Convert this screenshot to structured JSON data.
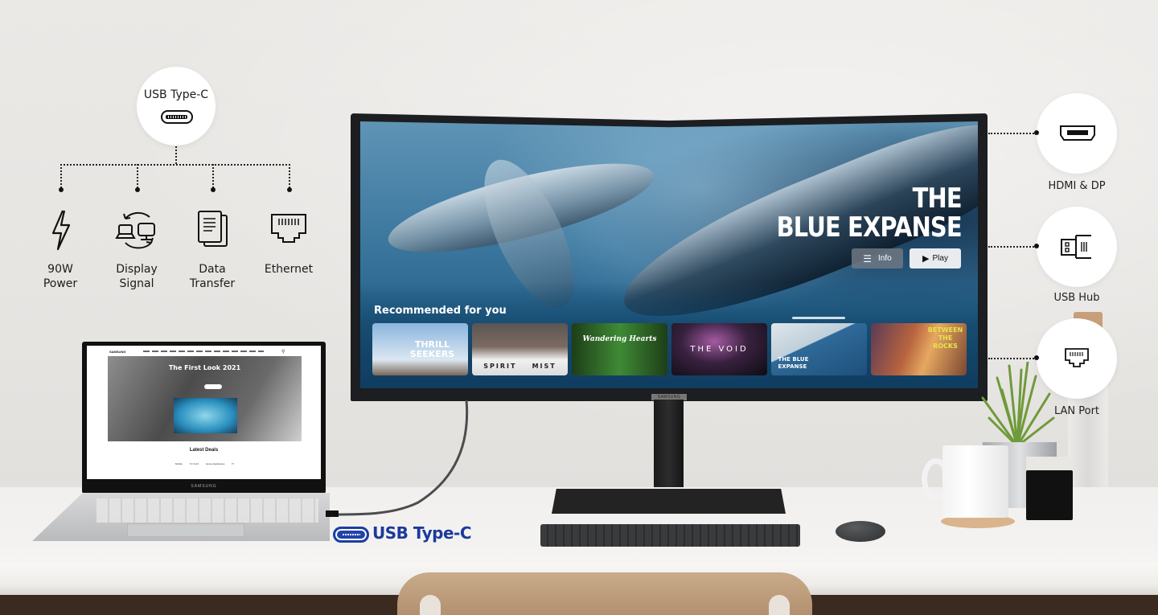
{
  "left_diagram": {
    "source_port": {
      "label": "USB Type-C",
      "icon": "usb-c-port-icon"
    },
    "features": [
      {
        "icon": "lightning-bolt-icon",
        "label_line1": "90W",
        "label_line2": "Power"
      },
      {
        "icon": "display-sync-icon",
        "label_line1": "Display",
        "label_line2": "Signal"
      },
      {
        "icon": "document-copy-icon",
        "label_line1": "Data",
        "label_line2": "Transfer"
      },
      {
        "icon": "ethernet-port-icon",
        "label_line1": "Ethernet",
        "label_line2": ""
      }
    ]
  },
  "right_ports": [
    {
      "label": "HDMI & DP",
      "icon": "hdmi-port-icon"
    },
    {
      "label": "USB Hub",
      "icon": "usb-hub-icon"
    },
    {
      "label": "LAN Port",
      "icon": "lan-port-icon"
    }
  ],
  "monitor": {
    "brand_label": "SAMSUNG",
    "screen": {
      "hero_title_line1": "THE",
      "hero_title_line2": "BLUE EXPANSE",
      "info_button": "Info",
      "play_button": "Play",
      "section_title": "Recommended for you",
      "cards": [
        {
          "title": "THRILL SEEKERS",
          "color": "#7aa8d4"
        },
        {
          "title": "SPIRIT    MIST",
          "color": "#7a6a63"
        },
        {
          "title": "Wandering Hearts",
          "color": "#2f6b2a"
        },
        {
          "title": "THE VOID",
          "color": "#2a1e30"
        },
        {
          "title": "THE BLUE EXPANSE",
          "color": "#3f79a8"
        },
        {
          "title": "BETWEEN THE ROCKS",
          "color": "#a35a3a"
        }
      ],
      "title_accent": "#e8e34a"
    }
  },
  "laptop": {
    "brand_label": "SAMSUNG",
    "website": {
      "logo": "SAMSUNG",
      "hero_title": "The First Look 2021",
      "section_title": "Latest Deals",
      "tabs": [
        "Mobile",
        "TV & AV",
        "Home Appliances",
        "IT"
      ]
    }
  },
  "connection_label": {
    "text": "USB Type-C",
    "color": "#1b3a9c"
  }
}
